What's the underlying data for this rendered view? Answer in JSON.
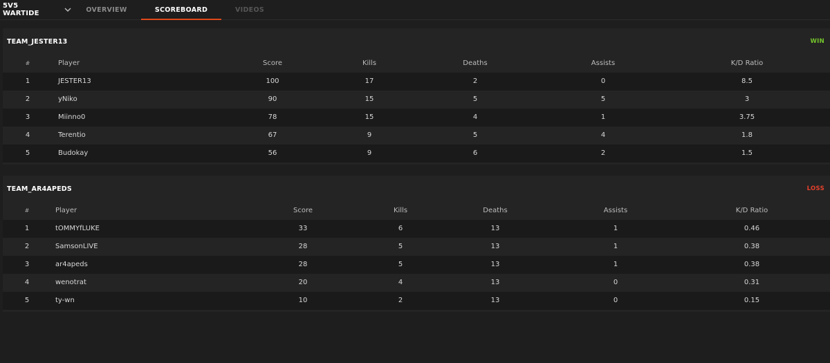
{
  "nav": {
    "game_title": "5V5 WARTIDE",
    "tabs": [
      "OVERVIEW",
      "SCOREBOARD",
      "VIDEOS"
    ],
    "active_tab": "SCOREBOARD"
  },
  "columns": [
    "#",
    "Player",
    "Score",
    "Kills",
    "Deaths",
    "Assists",
    "K/D Ratio"
  ],
  "teams": [
    {
      "name": "TEAM_JESTER13",
      "result": "WIN",
      "result_color": "#74c52b",
      "rows": [
        [
          "1",
          "JESTER13",
          "100",
          "17",
          "2",
          "0",
          "8.5"
        ],
        [
          "2",
          "yNiko",
          "90",
          "15",
          "5",
          "5",
          "3"
        ],
        [
          "3",
          "Miinno0",
          "78",
          "15",
          "4",
          "1",
          "3.75"
        ],
        [
          "4",
          "Terentio",
          "67",
          "9",
          "5",
          "4",
          "1.8"
        ],
        [
          "5",
          "Budokay",
          "56",
          "9",
          "6",
          "2",
          "1.5"
        ]
      ]
    },
    {
      "name": "TEAM_AR4APEDS",
      "result": "LOSS",
      "result_color": "#e5402c",
      "rows": [
        [
          "1",
          "tOMMYfLUKE",
          "33",
          "6",
          "13",
          "1",
          "0.46"
        ],
        [
          "2",
          "SamsonLIVE",
          "28",
          "5",
          "13",
          "1",
          "0.38"
        ],
        [
          "3",
          "ar4apeds",
          "28",
          "5",
          "13",
          "1",
          "0.38"
        ],
        [
          "4",
          "wenotrat",
          "20",
          "4",
          "13",
          "0",
          "0.31"
        ],
        [
          "5",
          "ty-wn",
          "10",
          "2",
          "13",
          "0",
          "0.15"
        ]
      ]
    }
  ],
  "accent_color": "#e0491b"
}
